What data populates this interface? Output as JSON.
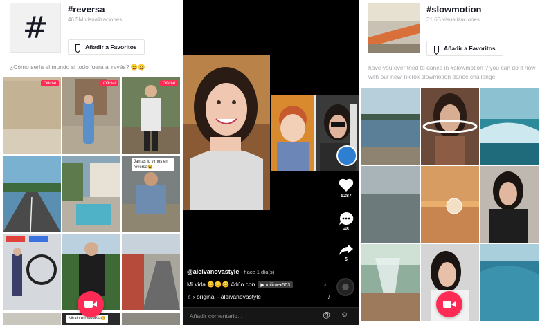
{
  "colors": {
    "accent": "#fe2c55",
    "text": "#161823",
    "muted": "#a6a7ab"
  },
  "left": {
    "header": {
      "icon": "hashtag-icon",
      "title": "#reversa",
      "views": "46.5M visualizaciones",
      "favorite_label": "Añadir a Favoritos"
    },
    "description": "¿Cómo sería el mundo si todo fuera al revés? 😀😀",
    "tiles": [
      {
        "badge": "Oficial"
      },
      {
        "badge": "Oficial"
      },
      {
        "badge": "Oficial"
      },
      {
        "caption": ""
      },
      {
        "caption": ""
      },
      {
        "caption": "Jamas lo vimos en reversa😂"
      },
      {
        "caption": ""
      },
      {
        "caption": ""
      },
      {
        "caption": ""
      }
    ],
    "bottom_captions": [
      "Miralo en reversa😂",
      ""
    ]
  },
  "middle": {
    "side": {
      "likes": "5287",
      "comments": "48",
      "shares": "5"
    },
    "author": "@aleivanovastyle",
    "time_ago": "· hace 1 día(s)",
    "caption_text": "Mi vida 😊😊😊 #dúo con",
    "duo_chip": "▶ milimex503",
    "sound": "› original - aleivanovastyle",
    "comment_placeholder": "Añadir comentario..."
  },
  "right": {
    "header": {
      "title": "#slowmotion",
      "views": "31.6B visualizaciones",
      "favorite_label": "Añadir a Favoritos"
    },
    "description": "have you ever tried to dance in #slowmotion ? you can do it now with our new TikTok slowmotion dance challenge"
  }
}
